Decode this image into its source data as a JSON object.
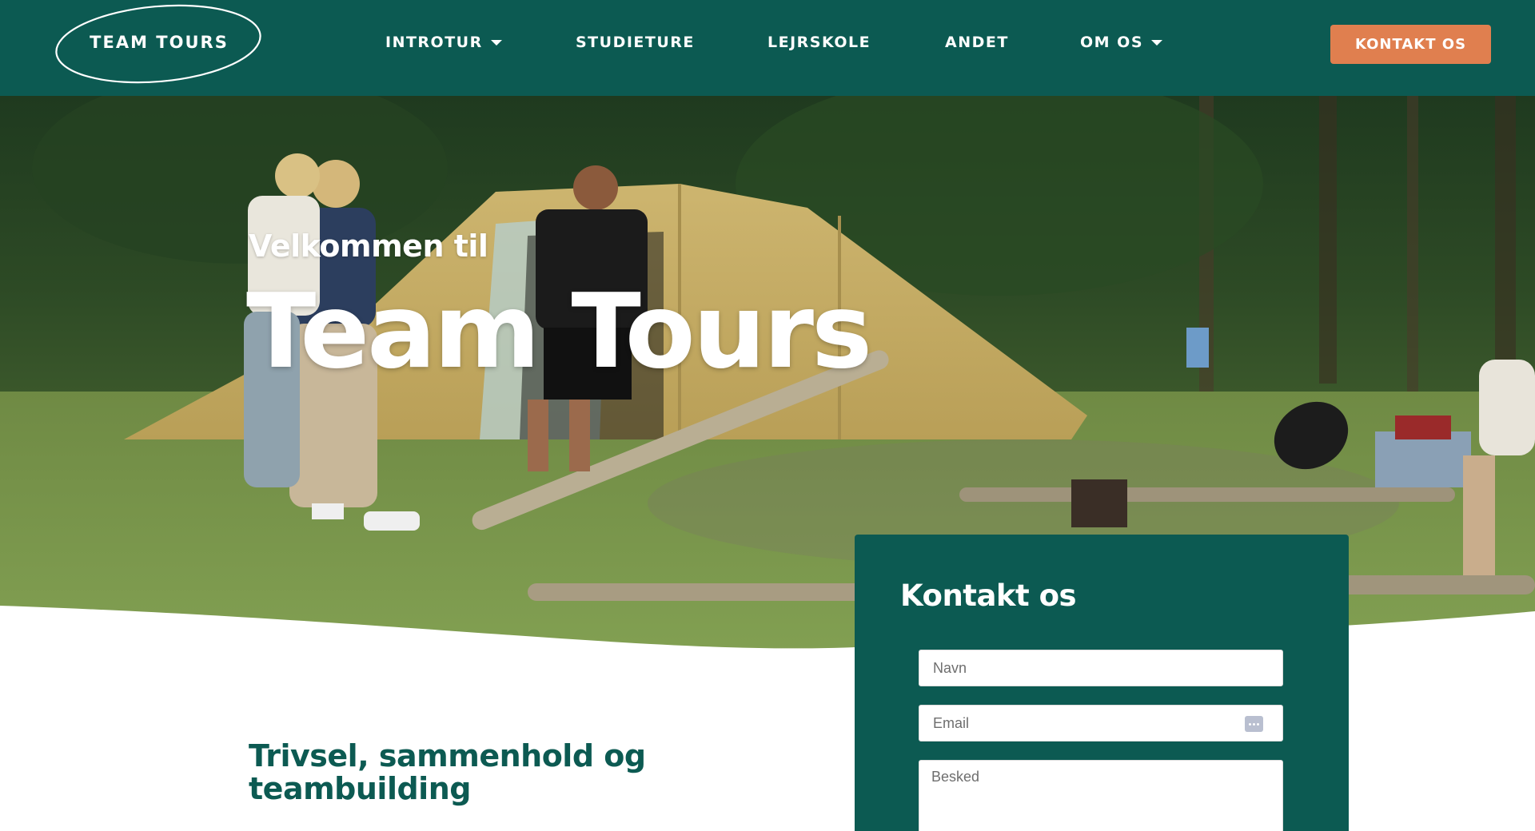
{
  "brand": {
    "logo_text": "TEAM TOURS"
  },
  "nav": {
    "items": [
      {
        "label": "INTROTUR",
        "has_dropdown": true
      },
      {
        "label": "STUDIETURE",
        "has_dropdown": false
      },
      {
        "label": "LEJRSKOLE",
        "has_dropdown": false
      },
      {
        "label": "ANDET",
        "has_dropdown": false
      },
      {
        "label": "OM OS",
        "has_dropdown": true
      }
    ],
    "cta_label": "KONTAKT OS"
  },
  "hero": {
    "subtitle": "Velkommen til",
    "title": "Team Tours"
  },
  "intro": {
    "heading": "Trivsel, sammenhold og teambuilding"
  },
  "contact": {
    "title": "Kontakt os",
    "name_placeholder": "Navn",
    "email_placeholder": "Email",
    "message_placeholder": "Besked"
  },
  "colors": {
    "brand_green": "#0c5a52",
    "accent_orange": "#e07f4f",
    "white": "#ffffff"
  },
  "icons": [
    "chevron-down-icon",
    "password-manager-icon"
  ]
}
